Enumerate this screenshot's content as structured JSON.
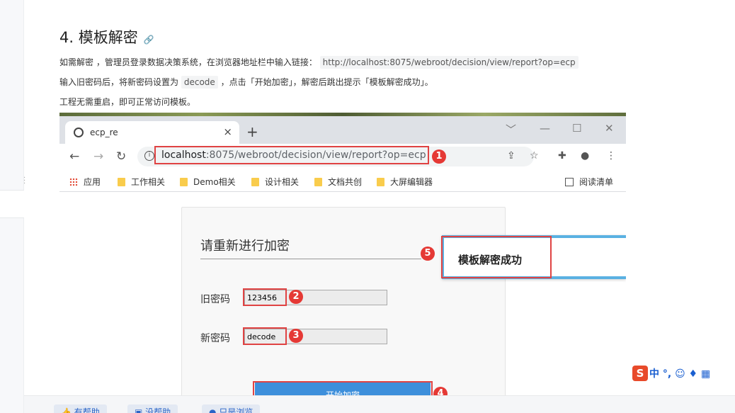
{
  "heading": {
    "title": "4. 模板解密",
    "anchor_icon": "link-icon"
  },
  "para1": {
    "text": "如需解密 ，管理员登录数据决策系统，在浏览器地址栏中输入链接：",
    "code": "http://localhost:8075/webroot/decision/view/report?op=ecp"
  },
  "para2": {
    "before": "输入旧密码后，将新密码设置为",
    "code": "decode",
    "after": "，点击「开始加密」，解密后跳出提示「模板解密成功」。"
  },
  "para3": {
    "text": "工程无需重启，即可正常访问模板。"
  },
  "browser": {
    "tab_title": "ecp_re",
    "tab_close": "×",
    "new_tab": "+",
    "win_controls": [
      "﹀",
      "—",
      "☐",
      "✕"
    ],
    "url_host": "localhost",
    "url_rest": ":8075/webroot/decision/view/report?op=ecp",
    "bookmarks": [
      "应用",
      "工作相关",
      "Demo相关",
      "设计相关",
      "文档共创",
      "大屏编辑器"
    ],
    "reading_list": "阅读清单"
  },
  "form": {
    "title": "请重新进行加密",
    "old_label": "旧密码",
    "old_value": "123456",
    "new_label": "新密码",
    "new_value": "decode",
    "submit": "开始加密"
  },
  "toast": {
    "message": "模板解密成功"
  },
  "badges": [
    "1",
    "2",
    "3",
    "4",
    "5"
  ],
  "ime": {
    "logo": "S",
    "text": "中 °, ☺ ♦ ▦"
  },
  "bottom": {
    "b1": "有帮助",
    "b2": "没帮助",
    "b3": "只是浏览"
  },
  "colors": {
    "annotation_red": "#e04343",
    "badge_red": "#e53935",
    "button_blue": "#3d8fdb",
    "toast_border": "#5ab1e2"
  }
}
